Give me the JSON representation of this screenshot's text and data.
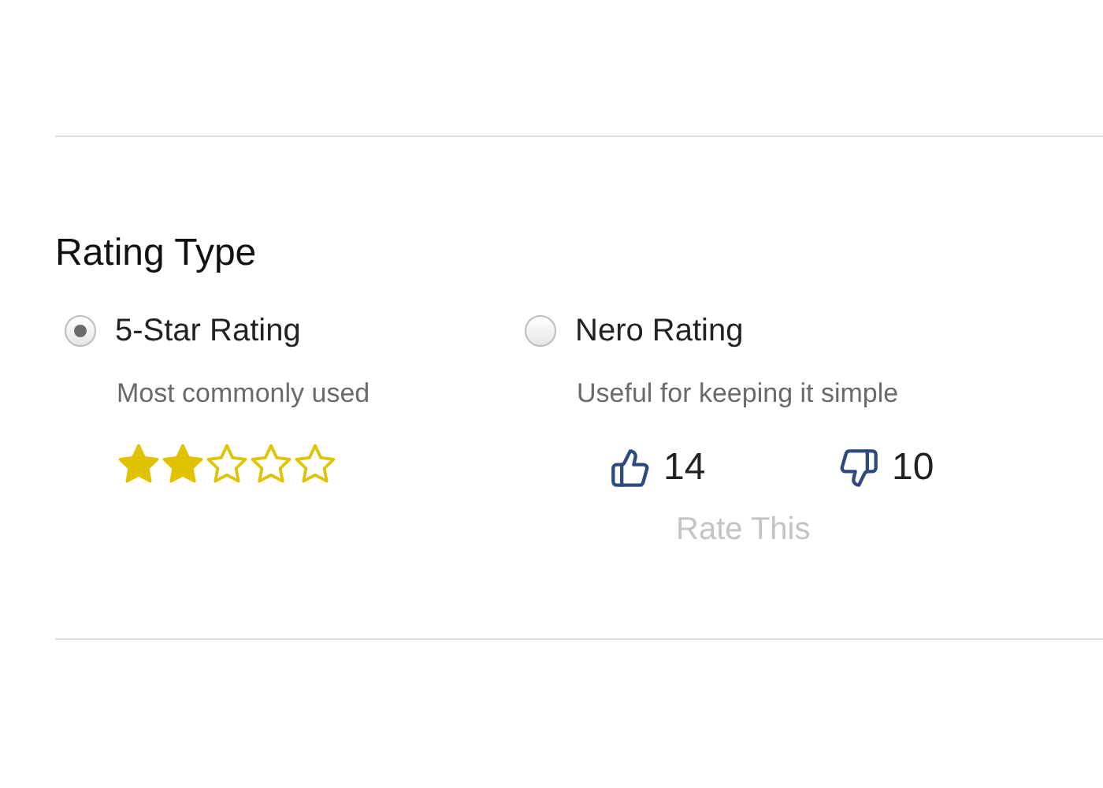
{
  "section": {
    "title": "Rating Type"
  },
  "options": [
    {
      "kind": "stars",
      "label": "5-Star Rating",
      "description": "Most commonly used",
      "selected": true,
      "stars": 2
    },
    {
      "kind": "thumbs",
      "label": "Nero Rating",
      "description": "Useful for keeping it simple",
      "selected": false,
      "up_count": "14",
      "down_count": "10",
      "action": "Rate This"
    }
  ]
}
